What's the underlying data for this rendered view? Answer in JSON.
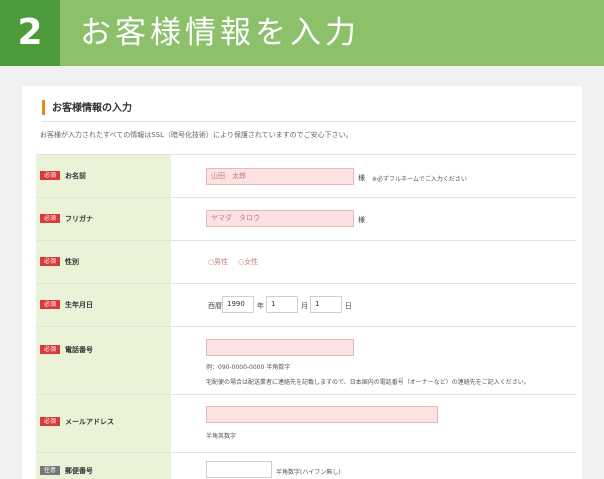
{
  "banner": {
    "step_number": "2",
    "title": "お客様情報を入力"
  },
  "section": {
    "title": "お客様情報の入力",
    "note": "お客様が入力されたすべての情報はSSL（暗号化技術）により保護されていますのでご安心下さい。"
  },
  "badges": {
    "required": "必須",
    "optional": "任意"
  },
  "fields": {
    "name": {
      "label": "お名前",
      "value": "山田　太郎",
      "suffix": "様",
      "hint": "※必ずフルネームでご入力ください"
    },
    "kana": {
      "label": "フリガナ",
      "value": "ヤマダ　タロウ",
      "suffix": "様"
    },
    "gender": {
      "label": "性別",
      "options": [
        "男性",
        "女性"
      ]
    },
    "birthday": {
      "label": "生年月日",
      "prefix": "西暦",
      "year": "1990",
      "year_unit": "年",
      "month": "1",
      "month_unit": "月",
      "day": "1",
      "day_unit": "日"
    },
    "phone": {
      "label": "電話番号",
      "example": "例：090-0000-0000 半角数字",
      "note": "宅配便の場合は配送業者に連絡先を記載しますので、日本国内の電話番号（オーナーなど）の連絡先をご記入ください。"
    },
    "email": {
      "label": "メールアドレス",
      "hint": "半角英数字"
    },
    "postal": {
      "label": "郵便番号",
      "hint": "半角数字(ハイフン無し)"
    }
  }
}
